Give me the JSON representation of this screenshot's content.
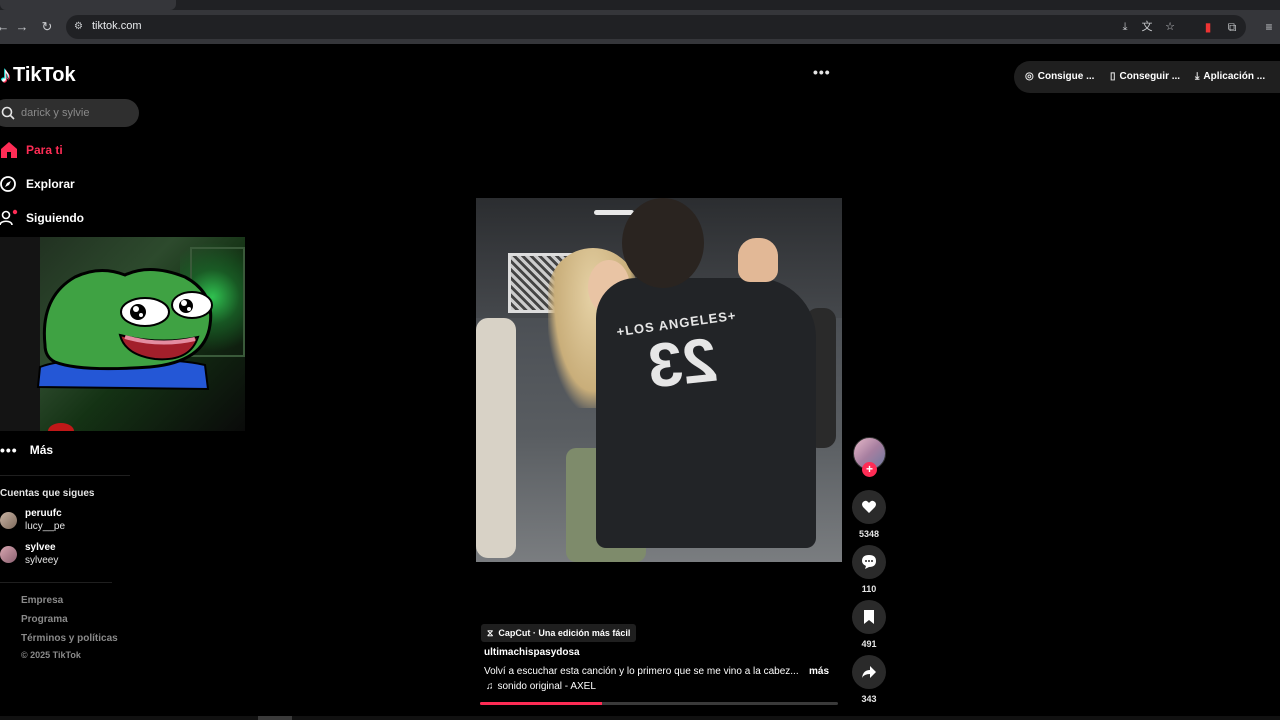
{
  "browser": {
    "url": "tiktok.com"
  },
  "brand": {
    "name": "TikTok",
    "accent": "#fe2c55"
  },
  "search": {
    "placeholder": "darick y sylvie"
  },
  "nav": {
    "items": [
      {
        "label": "Para ti",
        "icon": "home-icon",
        "active": true
      },
      {
        "label": "Explorar",
        "icon": "compass-icon",
        "active": false
      },
      {
        "label": "Siguiendo",
        "icon": "following-icon",
        "active": false
      }
    ],
    "more_label": "Más"
  },
  "following": {
    "title": "Cuentas que sigues",
    "accounts": [
      {
        "name": "peruufc",
        "handle": "lucy__pe"
      },
      {
        "name": "sylvee",
        "handle": "sylveey"
      }
    ]
  },
  "footer": {
    "links": [
      "Empresa",
      "Programa",
      "Términos y políticas"
    ],
    "copyright": "© 2025 TikTok"
  },
  "top_actions": [
    {
      "label": "Consigue ...",
      "icon": "coin-icon"
    },
    {
      "label": "Conseguir ...",
      "icon": "phone-icon"
    },
    {
      "label": "Aplicación ...",
      "icon": "download-icon"
    }
  ],
  "video": {
    "jersey_text": "+LOS ANGELES+",
    "jersey_number": "23",
    "progress": 0.34
  },
  "actions": {
    "likes": "5348",
    "comments": "110",
    "saves": "491",
    "shares": "343"
  },
  "caption": {
    "badge": "CapCut · Una edición más fácil",
    "username": "ultimachispasydosa",
    "description": "Volví a escuchar esta canción y lo primero que se me vino a la cabez...",
    "more": "más",
    "sound": "sonido original - AXEL"
  }
}
